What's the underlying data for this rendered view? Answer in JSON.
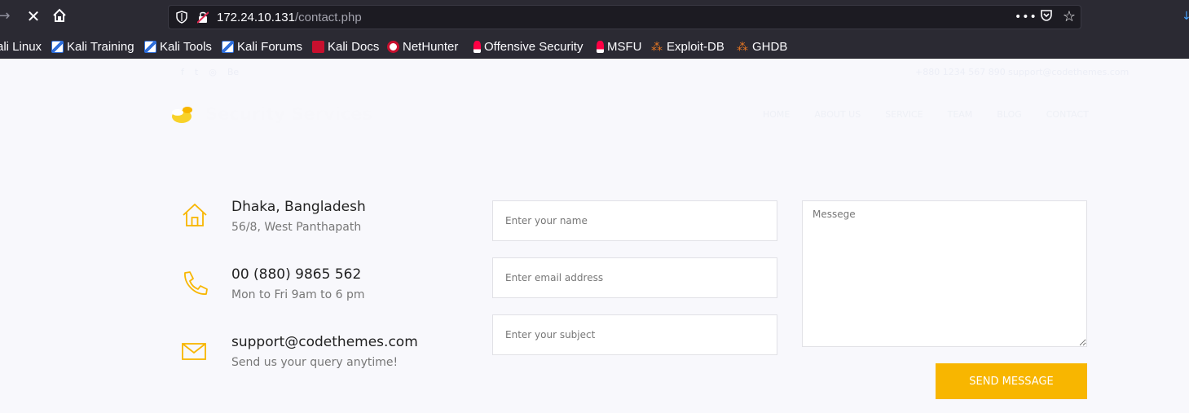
{
  "browser": {
    "url_host": "172.24.10.131",
    "url_path": "/contact.php",
    "url_actions_label": "•••"
  },
  "bookmarks": [
    {
      "label": "ali Linux",
      "favicon": "kali-icon"
    },
    {
      "label": "Kali Training",
      "favicon": "kali-icon"
    },
    {
      "label": "Kali Tools",
      "favicon": "kali-icon"
    },
    {
      "label": "Kali Forums",
      "favicon": "kali-icon"
    },
    {
      "label": "Kali Docs",
      "favicon": "kali-docs-icon"
    },
    {
      "label": "NetHunter",
      "favicon": "nethunter-icon"
    },
    {
      "label": "Offensive Security",
      "favicon": "offsec-icon"
    },
    {
      "label": "MSFU",
      "favicon": "offsec-icon"
    },
    {
      "label": "Exploit-DB",
      "favicon": "exploitdb-icon"
    },
    {
      "label": "GHDB",
      "favicon": "exploitdb-icon"
    }
  ],
  "site": {
    "brand": "Security Services",
    "topbar_contact": "+880 1234 567 890   support@codethemes.com",
    "nav": [
      "Home",
      "About Us",
      "Service",
      "Team",
      "Blog",
      "Contact"
    ]
  },
  "contact_info": {
    "address": {
      "title": "Dhaka, Bangladesh",
      "sub": "56/8, West Panthapath",
      "icon": "home-icon"
    },
    "phone": {
      "title": "00 (880) 9865 562",
      "sub": "Mon to Fri 9am to 6 pm",
      "icon": "phone-icon"
    },
    "email": {
      "title": "support@codethemes.com",
      "sub": "Send us your query anytime!",
      "icon": "mail-icon"
    }
  },
  "form": {
    "name_placeholder": "Enter your name",
    "email_placeholder": "Enter email address",
    "subject_placeholder": "Enter your subject",
    "message_placeholder": "Messege",
    "submit_label": "Send Message"
  },
  "colors": {
    "accent": "#f8b600",
    "toolbar_bg": "#2b2a33",
    "page_bg": "#f8f8fc"
  }
}
